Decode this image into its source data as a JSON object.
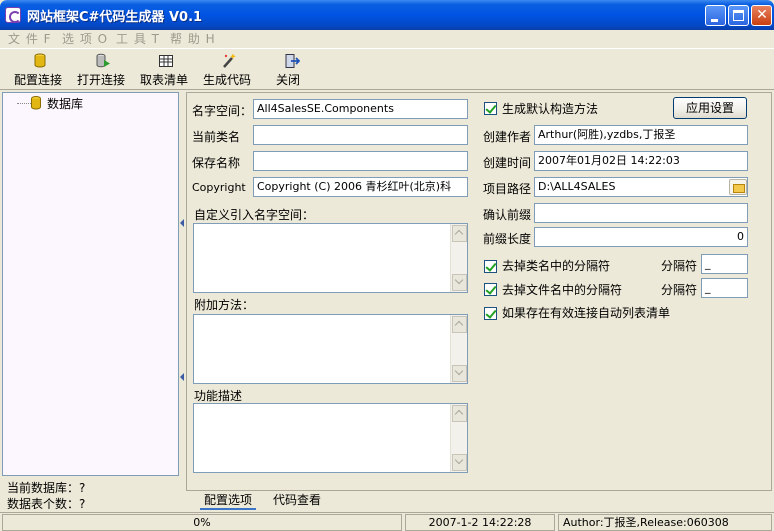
{
  "window": {
    "title": "网站框架C#代码生成器 V0.1",
    "controls": [
      "minimize-icon",
      "maximize-icon",
      "close-icon"
    ]
  },
  "menu": [
    {
      "label": "文 件 F"
    },
    {
      "label": "选 项 O"
    },
    {
      "label": "工 具 T"
    },
    {
      "label": "帮 助 H"
    }
  ],
  "toolbar": [
    {
      "label": "配置连接",
      "icon": "database-icon"
    },
    {
      "label": "打开连接",
      "icon": "open-connection-icon"
    },
    {
      "label": "取表清单",
      "icon": "table-list-icon"
    },
    {
      "label": "生成代码",
      "icon": "magic-wand-icon"
    },
    {
      "label": "关闭",
      "icon": "exit-icon"
    }
  ],
  "tree": {
    "root_label": "数据库"
  },
  "left_status": {
    "current_db": "当前数据库：?",
    "table_count": "数据表个数：?"
  },
  "form": {
    "namespace_label": "名字空间：",
    "namespace_value": "All4SalesSE.Components",
    "classname_label": "当前类名",
    "classname_value": "",
    "savename_label": "保存名称",
    "savename_value": "",
    "copyright_label": "Copyright",
    "copyright_value": "Copyright (C) 2006 青杉红叶(北京)科",
    "custom_ns_label": "自定义引入名字空间：",
    "extra_methods_label": "附加方法：",
    "description_label": "功能描述",
    "gen_ctor_label": "生成默认构造方法",
    "gen_ctor_checked": true,
    "apply_button": "应用设置",
    "author_label": "创建作者",
    "author_value": "Arthur(阿胜),yzdbs,丁报圣",
    "created_label": "创建时间",
    "created_value": "2007年01月02日 14:22:03",
    "path_label": "项目路径",
    "path_value": "D:\\ALL4SALES",
    "prefix_label": "确认前缀",
    "prefix_value": "",
    "prefix_len_label": "前缀长度",
    "prefix_len_value": "0",
    "strip_class_label": "去掉类名中的分隔符",
    "strip_class_checked": true,
    "sep1_label": "分隔符",
    "sep1_value": "_",
    "strip_file_label": "去掉文件名中的分隔符",
    "strip_file_checked": true,
    "sep2_label": "分隔符",
    "sep2_value": "_",
    "autolist_label": "如果存在有效连接自动列表清单",
    "autolist_checked": true
  },
  "tabs": [
    {
      "label": "配置选项",
      "active": true
    },
    {
      "label": "代码查看",
      "active": false
    }
  ],
  "status": {
    "progress": "0%",
    "datetime": "2007-1-2 14:22:28",
    "author": "Author:丁报圣,Release:060308"
  }
}
